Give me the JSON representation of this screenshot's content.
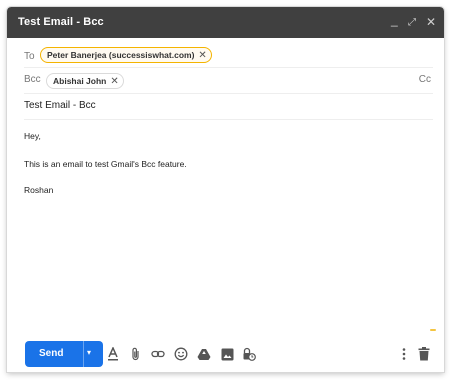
{
  "window": {
    "title": "Test Email - Bcc",
    "minimize_glyph": "_",
    "expand_glyph": "⤢",
    "close_glyph": "✕"
  },
  "to": {
    "label": "To",
    "recipients": [
      {
        "name": "Peter Banerjea (successiswhat.com)",
        "warning": true
      }
    ]
  },
  "bcc": {
    "label": "Bcc",
    "recipients": [
      {
        "name": "Abishai John",
        "warning": false
      }
    ]
  },
  "cc_link": "Cc",
  "subject": "Test Email - Bcc",
  "body": {
    "lines": [
      "Hey,",
      "This is an email to test Gmail's Bcc feature.",
      "Roshan"
    ]
  },
  "toolbar": {
    "send_label": "Send",
    "send_caret": "▾",
    "icons": [
      "formatting-icon",
      "attach-icon",
      "link-icon",
      "emoji-icon",
      "drive-icon",
      "photo-icon",
      "confidential-mode-icon",
      "more-options-icon",
      "trash-icon"
    ]
  },
  "colors": {
    "title_bar": "#404040",
    "send_button": "#1a73e8",
    "warning_chip_border": "#f4b400",
    "chip_border": "#dadada"
  }
}
